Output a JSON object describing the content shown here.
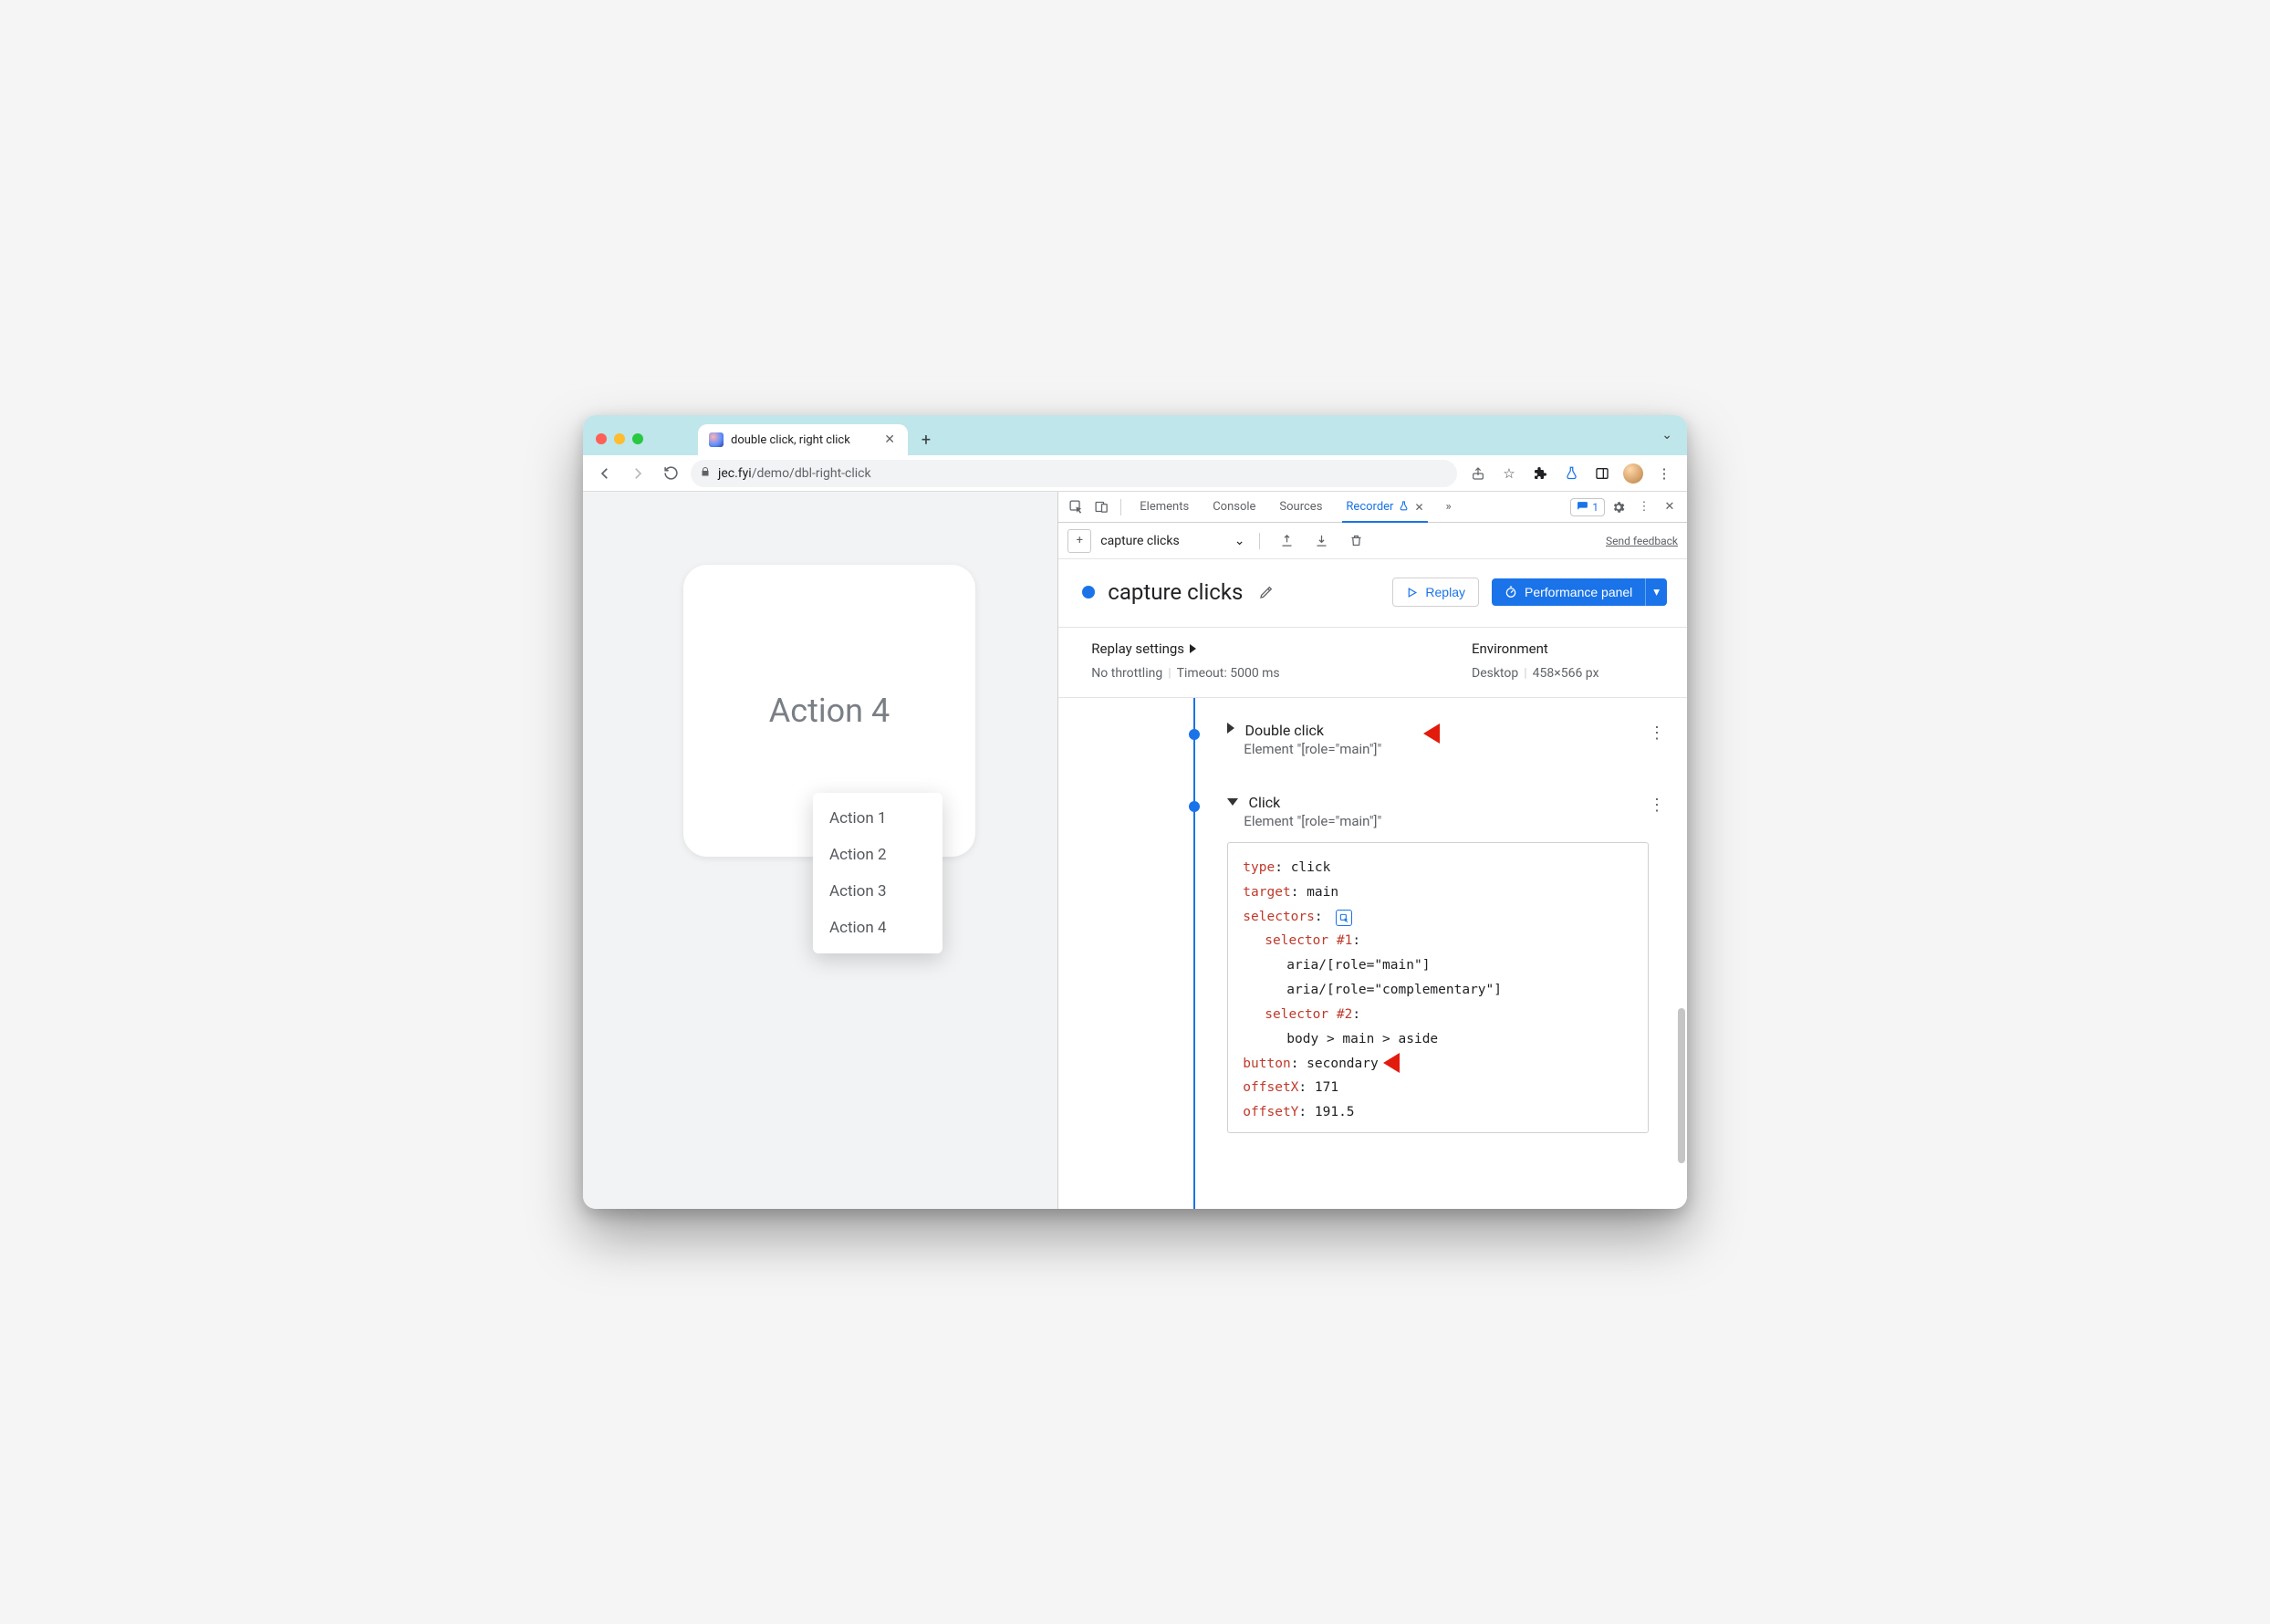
{
  "browser": {
    "tab_title": "double click, right click",
    "url_host": "jec.fyi",
    "url_path": "/demo/dbl-right-click"
  },
  "page": {
    "card_title": "Action 4",
    "menu_items": [
      "Action 1",
      "Action 2",
      "Action 3",
      "Action 4"
    ]
  },
  "devtools": {
    "panels": {
      "elements": "Elements",
      "console": "Console",
      "sources": "Sources",
      "recorder": "Recorder"
    },
    "issues_count": "1",
    "recorder": {
      "recording_selector": "capture clicks",
      "send_feedback": "Send feedback",
      "title": "capture clicks",
      "replay_btn": "Replay",
      "perf_btn": "Performance panel",
      "replay_settings_label": "Replay settings",
      "settings_throttling": "No throttling",
      "settings_timeout": "Timeout: 5000 ms",
      "env_label": "Environment",
      "env_device": "Desktop",
      "env_viewport": "458×566 px",
      "steps": [
        {
          "title": "Double click",
          "subtitle": "Element \"[role=\"main\"]\"",
          "expanded": false
        },
        {
          "title": "Click",
          "subtitle": "Element \"[role=\"main\"]\"",
          "expanded": true,
          "details": {
            "type": "click",
            "target": "main",
            "selectors_label": "selectors",
            "selector1_label": "selector #1",
            "selector1_a": "aria/[role=\"main\"]",
            "selector1_b": "aria/[role=\"complementary\"]",
            "selector2_label": "selector #2",
            "selector2_a": "body > main > aside",
            "button": "secondary",
            "offsetX": "171",
            "offsetY": "191.5"
          }
        }
      ],
      "detail_keys": {
        "type": "type",
        "target": "target",
        "button": "button",
        "offsetX": "offsetX",
        "offsetY": "offsetY"
      }
    }
  }
}
